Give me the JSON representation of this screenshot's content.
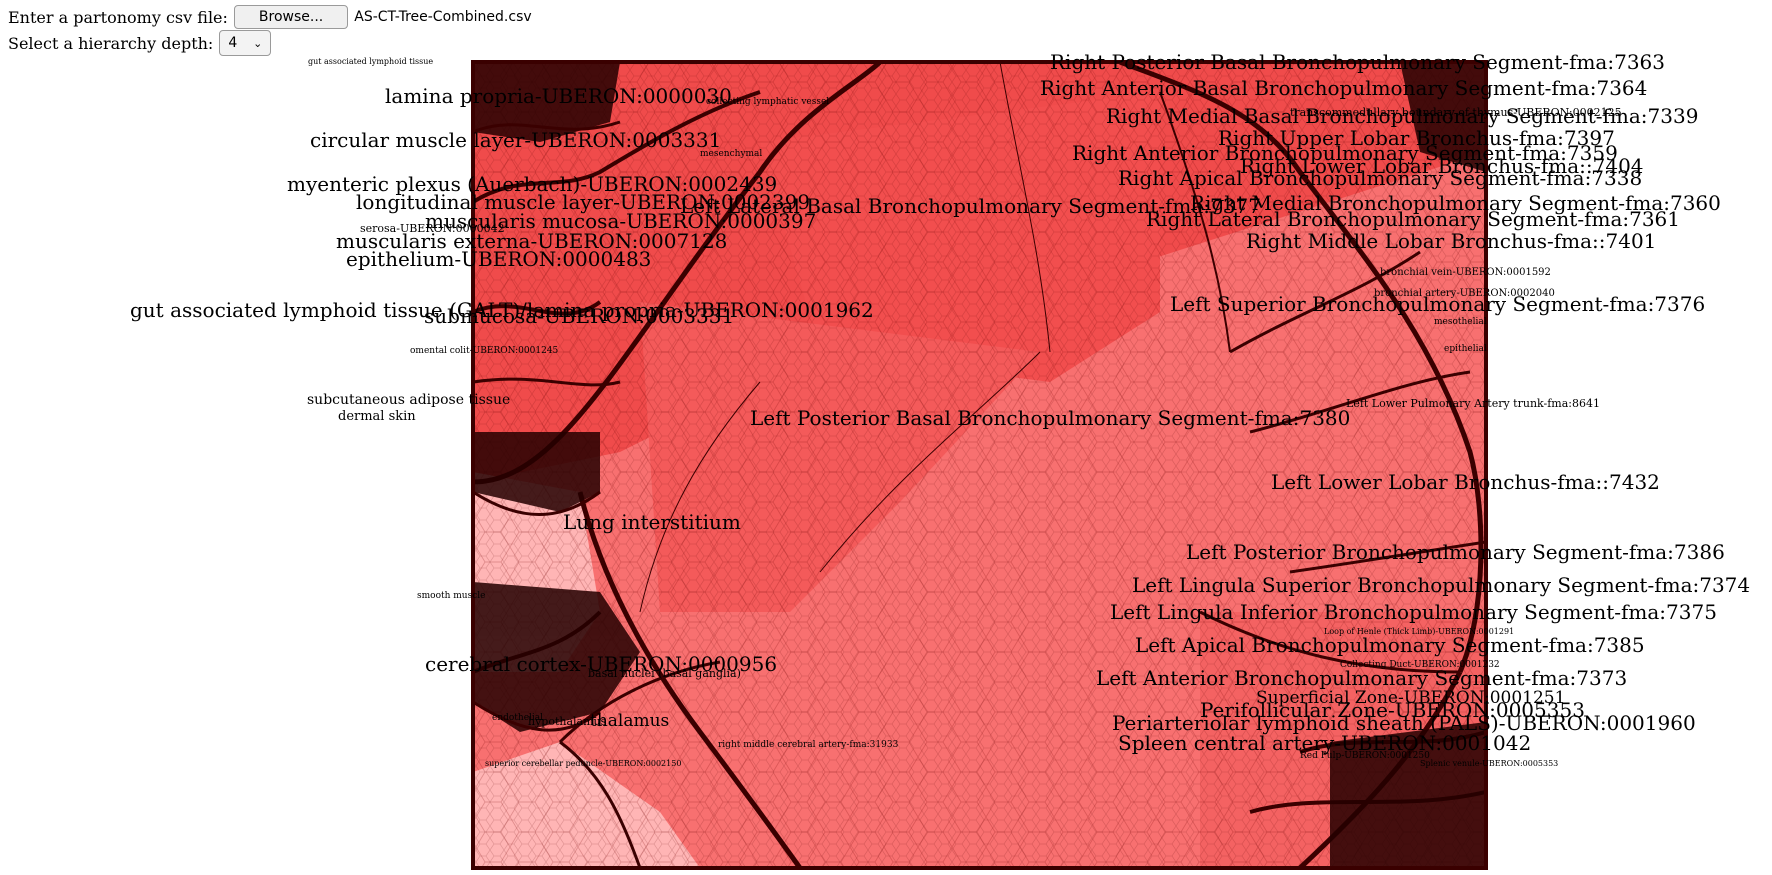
{
  "controls": {
    "csv_label": "Enter a partonomy csv file:",
    "browse_label": "Browse...",
    "file_name": "AS-CT-Tree-Combined.csv",
    "depth_label": "Select a hierarchy depth:",
    "depth_value": "4"
  },
  "treemap": {
    "colors": {
      "fill_dark": "#f04b4b",
      "fill_mid": "#f87070",
      "fill_light": "#ffb5b5",
      "border": "#3a0000"
    },
    "labels_large": [
      "Right Posterior Basal Bronchopulmonary Segment-fma:7363",
      "Right Anterior Basal Bronchopulmonary Segment-fma:7364",
      "Right Medial Basal Bronchopulmonary Segment-fma:7339",
      "Right Anterior Bronchopulmonary Segment-fma:7359",
      "Right Upper Lobar Bronchus-fma:7397",
      "Right Lower Lobar Bronchus-fma::7404",
      "Right Apical Bronchopulmonary Segment-fma:7338",
      "Right Medial Bronchopulmonary Segment-fma:7360",
      "Right Lateral Bronchopulmonary Segment-fma:7361",
      "Right Middle Lobar Bronchus-fma::7401",
      "Left Superior Bronchopulmonary Segment-fma:7376",
      "Left Posterior Basal Bronchopulmonary Segment-fma:7380",
      "Left Lower Lobar Bronchus-fma::7432",
      "Left Posterior Bronchopulmonary Segment-fma:7386",
      "Left Lingula Superior Bronchopulmonary Segment-fma:7374",
      "Left Lingula Inferior Bronchopulmonary Segment-fma:7375",
      "Left Apical Bronchopulmonary Segment-fma:7385",
      "Left Anterior Bronchopulmonary Segment-fma:7373",
      "Lung interstitium",
      "Perifollicular Zone-UBERON:0005353",
      "Superficial Zone-UBERON:0001251",
      "Periarteriolar lymphoid sheath (PALS)-UBERON:0001960",
      "Spleen central artery-UBERON:0001042",
      "Left Lateral Basal Bronchopulmonary Segment-fma:7377",
      "lamina propria-UBERON:0000030",
      "circular muscle layer-UBERON:0003331",
      "myenteric plexus (Auerbach)-UBERON:0002439",
      "longitudinal muscle layer-UBERON:0002399",
      "muscularis mucosa-UBERON:0000397",
      "muscularis externa-UBERON:0007128",
      "epithelium-UBERON:0000483",
      "gut associated lymphoid tissue (GALT)/lamina propria-UBERON:0001962",
      "submucosa-UBERON:0003331",
      "cerebral cortex-UBERON:0000956",
      "thalamus",
      "basal nuclei (basal ganglia)"
    ],
    "labels_small": [
      "bronchial vein-UBERON:0001592",
      "bronchial artery-UBERON:0002040",
      "mesothelial",
      "Left Lower Pulmonary Artery trunk-fma:8641",
      "transcommedullary boundary of thymus-UBERON:0002125",
      "omental colit-UBERON:0001245",
      "serosa-UBERON:0000042",
      "gut associated lymphoid tissue",
      "subcutaneous adipose tissue",
      "dermal skin",
      "Loop of Henle (Thick Limb)-UBERON:0001291",
      "Collecting Duct-UBERON:0001232",
      "endothelial",
      "hypothalamus",
      "right middle cerebral artery-fma:31933",
      "superior cerebellar peduncle-UBERON:0002150",
      "smooth muscle",
      "Red Pulp-UBERON:0001250",
      "collecting lymphatic vessel",
      "Splenic venule-UBERON:0005353",
      "mesenchymal",
      "epithelial"
    ]
  }
}
